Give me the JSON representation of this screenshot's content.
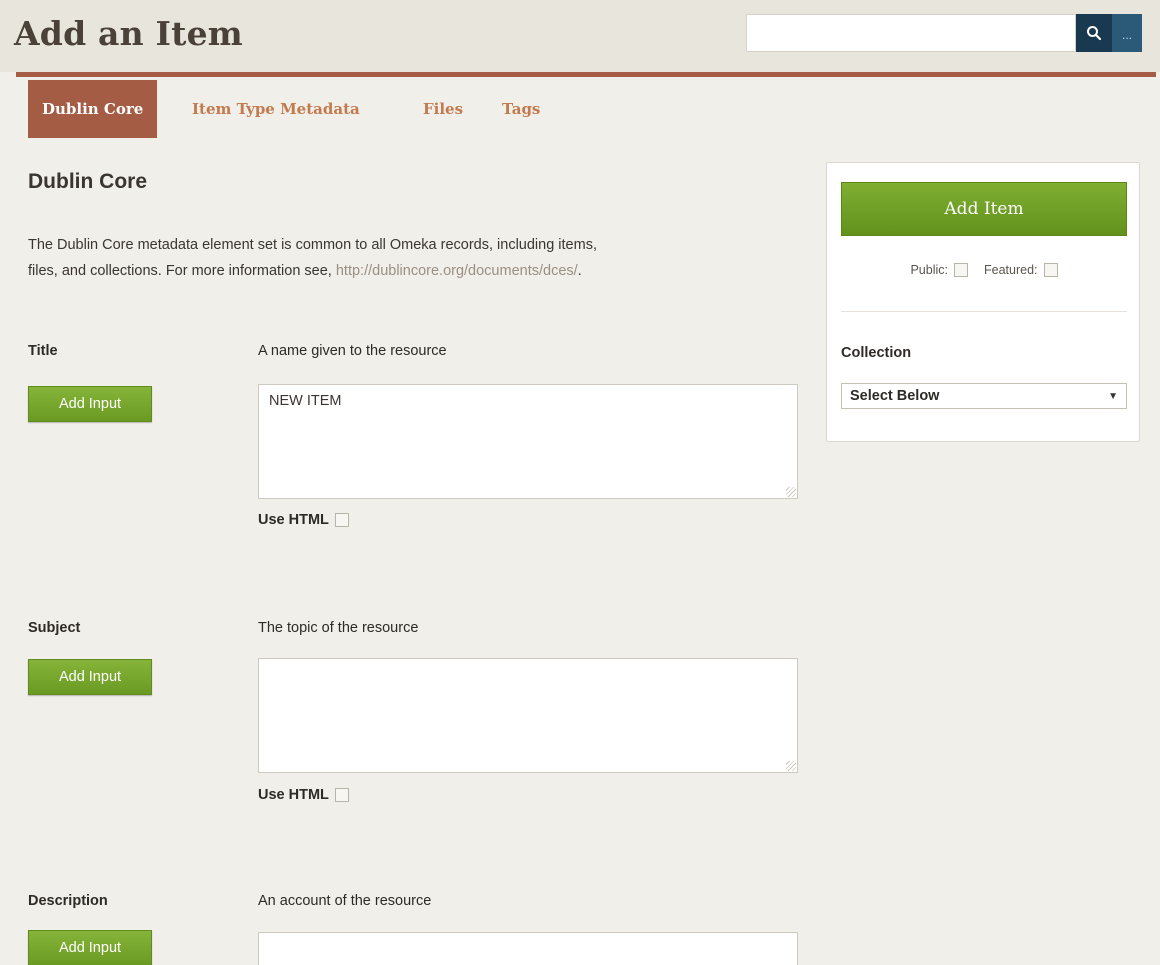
{
  "header": {
    "title": "Add an Item",
    "search_placeholder": "",
    "search_icon": "search-icon",
    "more_label": "..."
  },
  "tabs": [
    {
      "label": "Dublin Core",
      "active": true
    },
    {
      "label": "Item Type Metadata",
      "active": false
    },
    {
      "label": "Files",
      "active": false
    },
    {
      "label": "Tags",
      "active": false
    }
  ],
  "section": {
    "title": "Dublin Core",
    "description_line1": "The Dublin Core metadata element set is common to all Omeka records, including items,",
    "description_line2_prefix": "files, and collections. For more information see, ",
    "description_link": "http://dublincore.org/documents/dces/",
    "description_suffix": "."
  },
  "fields": [
    {
      "label": "Title",
      "hint": "A name given to the resource",
      "value": "NEW ITEM",
      "add_input_label": "Add Input",
      "use_html_label": "Use HTML"
    },
    {
      "label": "Subject",
      "hint": "The topic of the resource",
      "value": "",
      "add_input_label": "Add Input",
      "use_html_label": "Use HTML"
    },
    {
      "label": "Description",
      "hint": "An account of the resource",
      "value": "",
      "add_input_label": "Add Input"
    }
  ],
  "panel": {
    "add_item_label": "Add Item",
    "public_label": "Public:",
    "featured_label": "Featured:",
    "collection_label": "Collection",
    "collection_selected": "Select Below"
  },
  "colors": {
    "accent": "#a45c44",
    "tab_text": "#c27a4e",
    "button_green": "#6a9a22",
    "search_button": "#18394f"
  }
}
